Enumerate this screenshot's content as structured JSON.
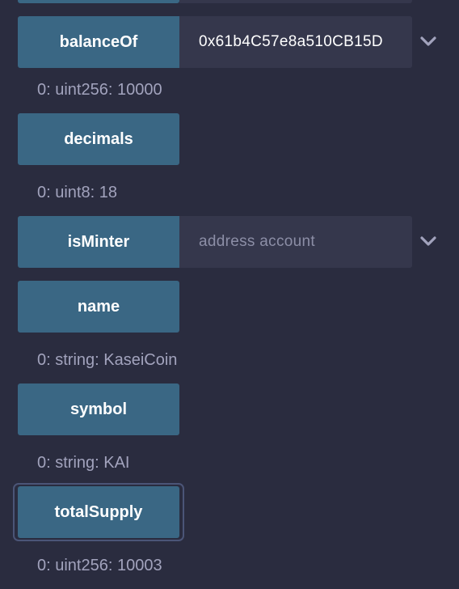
{
  "functions": [
    {
      "key": "balanceOf",
      "button_label": "balanceOf",
      "input_value": "0x61b4C57e8a510CB15D",
      "input_placeholder": "",
      "result": "0: uint256: 10000"
    },
    {
      "key": "decimals",
      "button_label": "decimals",
      "result": "0: uint8: 18"
    },
    {
      "key": "isMinter",
      "button_label": "isMinter",
      "input_value": "",
      "input_placeholder": "address account"
    },
    {
      "key": "name",
      "button_label": "name",
      "result": "0: string: KaseiCoin"
    },
    {
      "key": "symbol",
      "button_label": "symbol",
      "result": "0: string: KAI"
    },
    {
      "key": "totalSupply",
      "button_label": "totalSupply",
      "result": "0: uint256: 10003"
    }
  ],
  "icons": {
    "expand": "chevron-down-icon"
  },
  "colors": {
    "background": "#2a2c3f",
    "button": "#3a6784",
    "input": "#35374c",
    "result_text": "#a2a3bd",
    "chevron": "#a2a3bd"
  }
}
